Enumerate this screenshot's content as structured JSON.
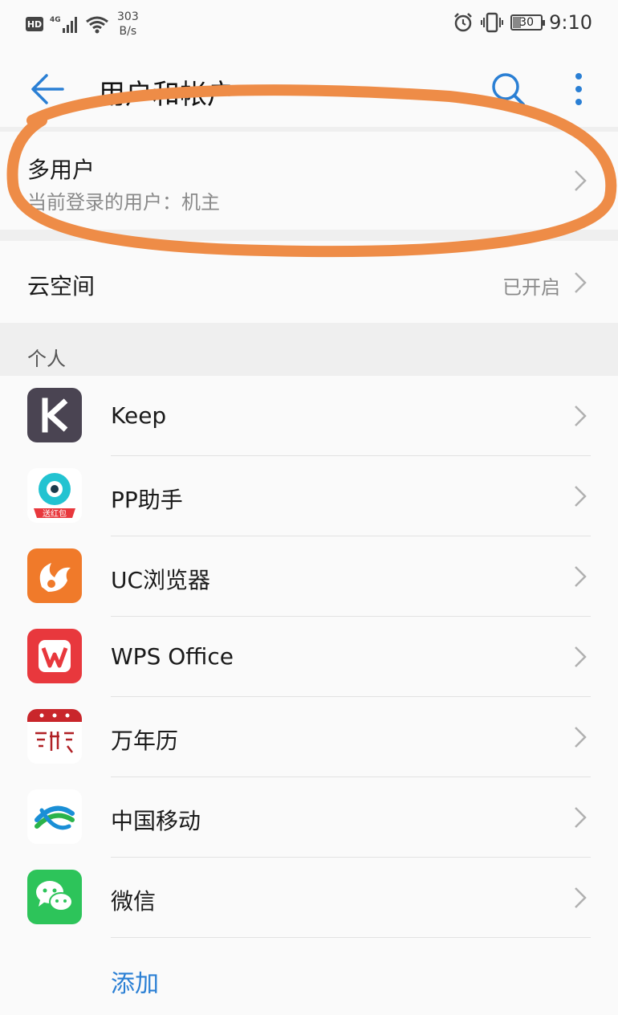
{
  "status_bar": {
    "hd": "HD",
    "network": "4G",
    "speed_value": "303",
    "speed_unit": "B/s",
    "battery": "30",
    "time": "9:10"
  },
  "header": {
    "title": "用户和帐户"
  },
  "multi_user": {
    "title": "多用户",
    "subtitle": "当前登录的用户：机主"
  },
  "cloud": {
    "title": "云空间",
    "status": "已开启"
  },
  "personal": {
    "section_label": "个人",
    "apps": [
      {
        "name": "Keep",
        "icon": "keep-icon"
      },
      {
        "name": "PP助手",
        "icon": "pp-assistant-icon",
        "badge": "送红包"
      },
      {
        "name": "UC浏览器",
        "icon": "uc-browser-icon"
      },
      {
        "name": "WPS Office",
        "icon": "wps-office-icon"
      },
      {
        "name": "万年历",
        "icon": "calendar-icon"
      },
      {
        "name": "中国移动",
        "icon": "china-mobile-icon"
      },
      {
        "name": "微信",
        "icon": "wechat-icon"
      }
    ],
    "add_label": "添加"
  },
  "colors": {
    "accent_blue": "#2a7fd4",
    "annotation_orange": "#ee8c47",
    "keep_bg": "#4a4452",
    "uc_orange": "#f07a2a",
    "wps_red": "#e8383d",
    "wechat_green": "#2dc45a"
  }
}
